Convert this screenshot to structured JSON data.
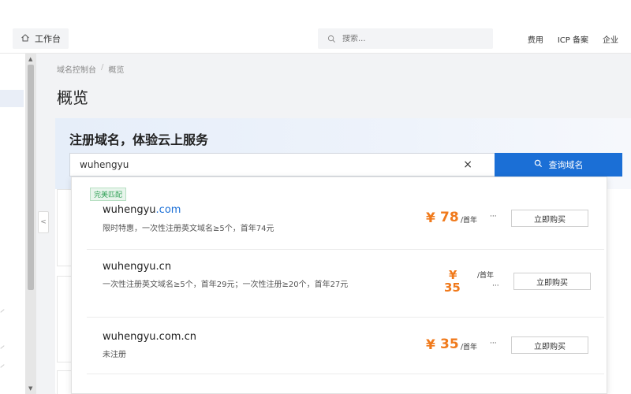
{
  "topnav": {
    "workbench_label": "工作台",
    "search_placeholder": "搜索...",
    "links": [
      "费用",
      "ICP 备案",
      "企业"
    ]
  },
  "breadcrumb": [
    "域名控制台",
    "概览"
  ],
  "page_title": "概览",
  "banner": {
    "title": "注册域名，体验云上服务",
    "input_value": "wuhengyu",
    "clear_icon": "×",
    "query_button_label": "查询域名"
  },
  "results": {
    "badge": "完美匹配",
    "items": [
      {
        "name": "wuhengyu",
        "tld": ".com",
        "desc": "限时特惠，一次性注册英文域名≥5个，首年74元",
        "currency": "¥",
        "price": "78",
        "unit": "/首年",
        "more": "···",
        "buy_label": "立即购买"
      },
      {
        "name": "wuhengyu",
        "tld": ".cn",
        "desc": "一次性注册英文域名≥5个，首年29元；一次性注册≥20个，首年27元",
        "currency": "¥",
        "price": "35",
        "unit": "/首年",
        "more": "···",
        "buy_label": "立即购买"
      },
      {
        "name": "wuhengyu",
        "tld": ".com.cn",
        "desc": "未注册",
        "currency": "¥",
        "price": "35",
        "unit": "/首年",
        "more": "···",
        "buy_label": "立即购买"
      }
    ]
  },
  "colors": {
    "primary": "#1b6fd6",
    "price": "#f07a1c",
    "badge_green": "#35a35a"
  }
}
